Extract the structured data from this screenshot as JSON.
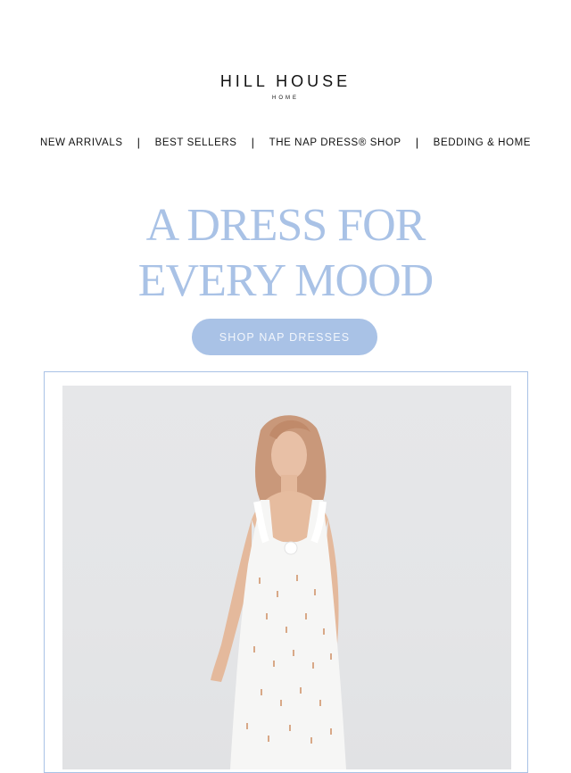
{
  "brand": {
    "name": "HILL HOUSE",
    "sub": "HOME"
  },
  "nav": {
    "items": [
      "NEW ARRIVALS",
      "BEST SELLERS",
      "THE NAP DRESS® SHOP",
      "BEDDING & HOME"
    ],
    "separator": "|"
  },
  "hero": {
    "headline_line1": "A DRESS FOR",
    "headline_line2": "EVERY MOOD",
    "cta_label": "SHOP NAP DRESSES"
  },
  "product_image": {
    "subject": "model-in-white-nap-dress"
  },
  "colors": {
    "accent": "#a9c2e6",
    "text": "#111111",
    "photo_bg": "#e5e6e8"
  }
}
